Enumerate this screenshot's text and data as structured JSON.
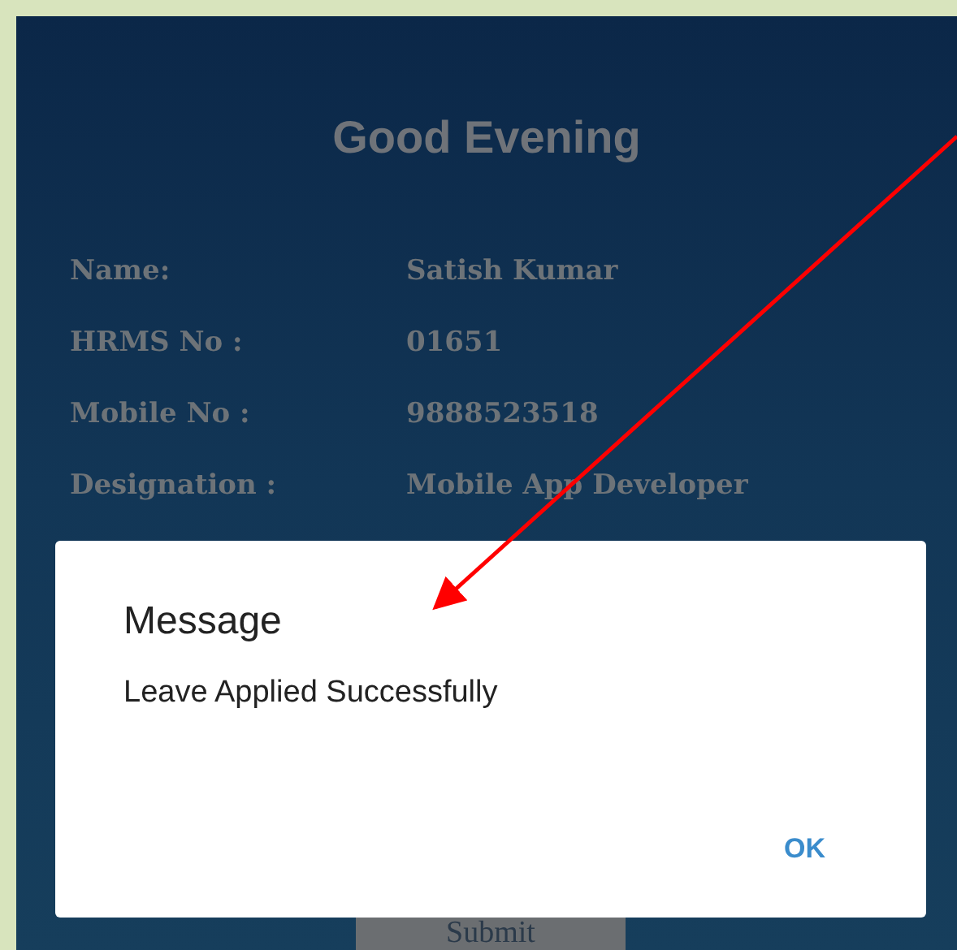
{
  "greeting": "Good Evening",
  "details": [
    {
      "label": "Name:",
      "value": "Satish Kumar"
    },
    {
      "label": "HRMS No :",
      "value": "01651"
    },
    {
      "label": "Mobile No :",
      "value": "9888523518"
    },
    {
      "label": "Designation :",
      "value": "Mobile App Developer"
    }
  ],
  "submit_button": "Submit",
  "dialog": {
    "title": "Message",
    "message": "Leave Applied Successfully",
    "button": "OK"
  }
}
